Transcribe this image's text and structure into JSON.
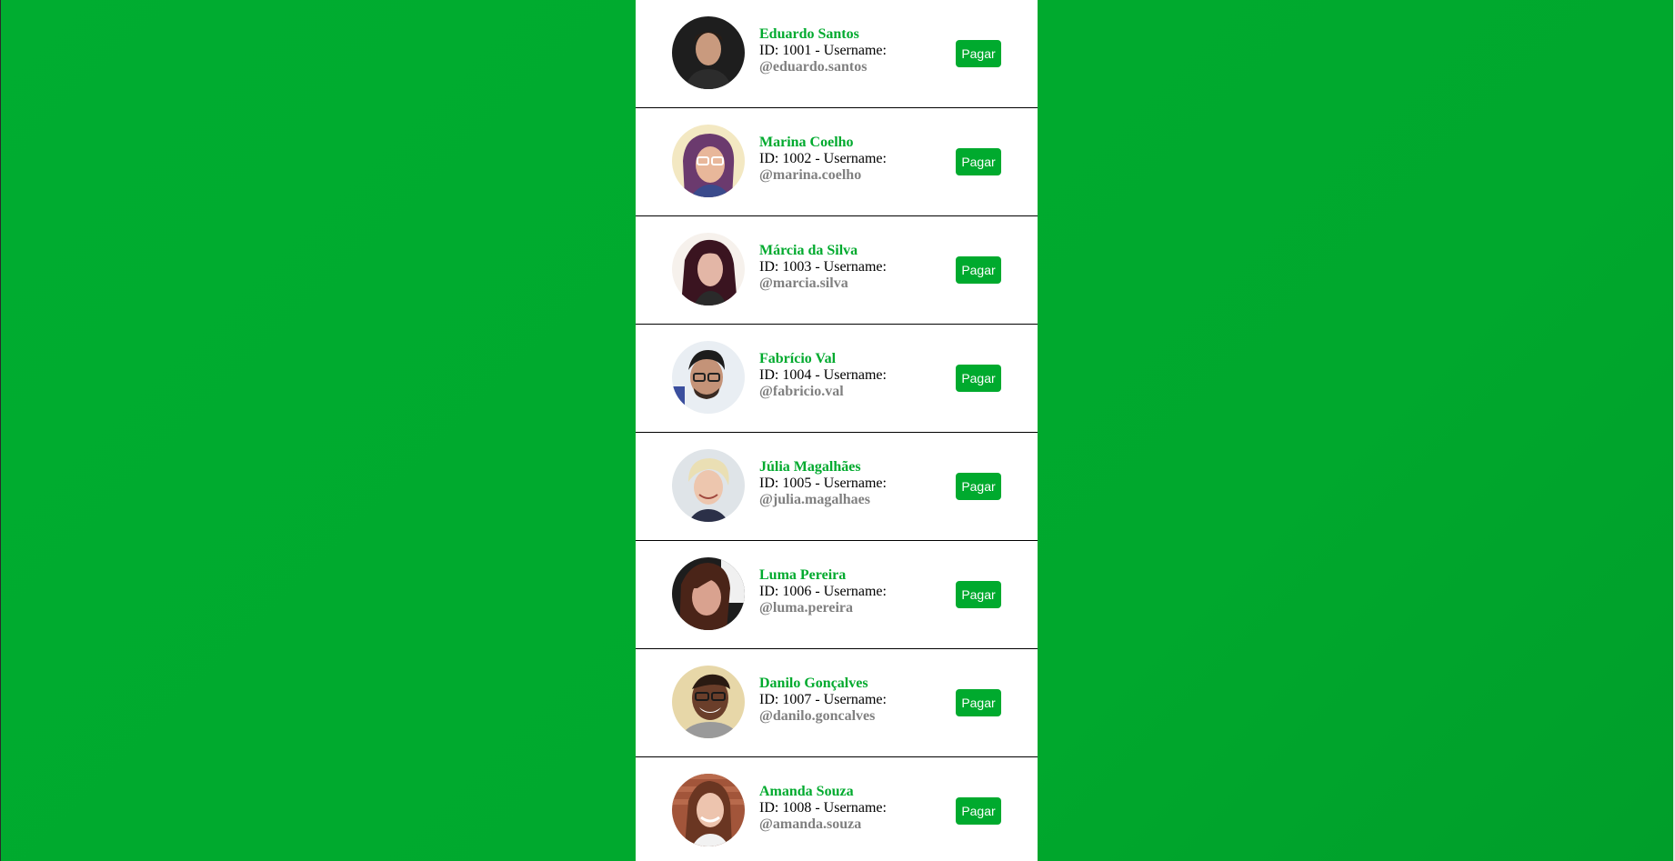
{
  "colors": {
    "background": "#00aa2e",
    "accent": "#00aa2e",
    "username": "#808080"
  },
  "contacts": [
    {
      "name": "Eduardo Santos",
      "meta": "ID: 1001 - Username:",
      "username": "@eduardo.santos",
      "pay_label": "Pagar"
    },
    {
      "name": "Marina Coelho",
      "meta": "ID: 1002 - Username:",
      "username": "@marina.coelho",
      "pay_label": "Pagar"
    },
    {
      "name": "Márcia da Silva",
      "meta": "ID: 1003 - Username:",
      "username": "@marcia.silva",
      "pay_label": "Pagar"
    },
    {
      "name": "Fabrício Val",
      "meta": "ID: 1004 - Username:",
      "username": "@fabricio.val",
      "pay_label": "Pagar"
    },
    {
      "name": "Júlia Magalhães",
      "meta": "ID: 1005 - Username:",
      "username": "@julia.magalhaes",
      "pay_label": "Pagar"
    },
    {
      "name": "Luma Pereira",
      "meta": "ID: 1006 - Username:",
      "username": "@luma.pereira",
      "pay_label": "Pagar"
    },
    {
      "name": "Danilo Gonçalves",
      "meta": "ID: 1007 - Username:",
      "username": "@danilo.goncalves",
      "pay_label": "Pagar"
    },
    {
      "name": "Amanda Souza",
      "meta": "ID: 1008 - Username:",
      "username": "@amanda.souza",
      "pay_label": "Pagar"
    }
  ]
}
